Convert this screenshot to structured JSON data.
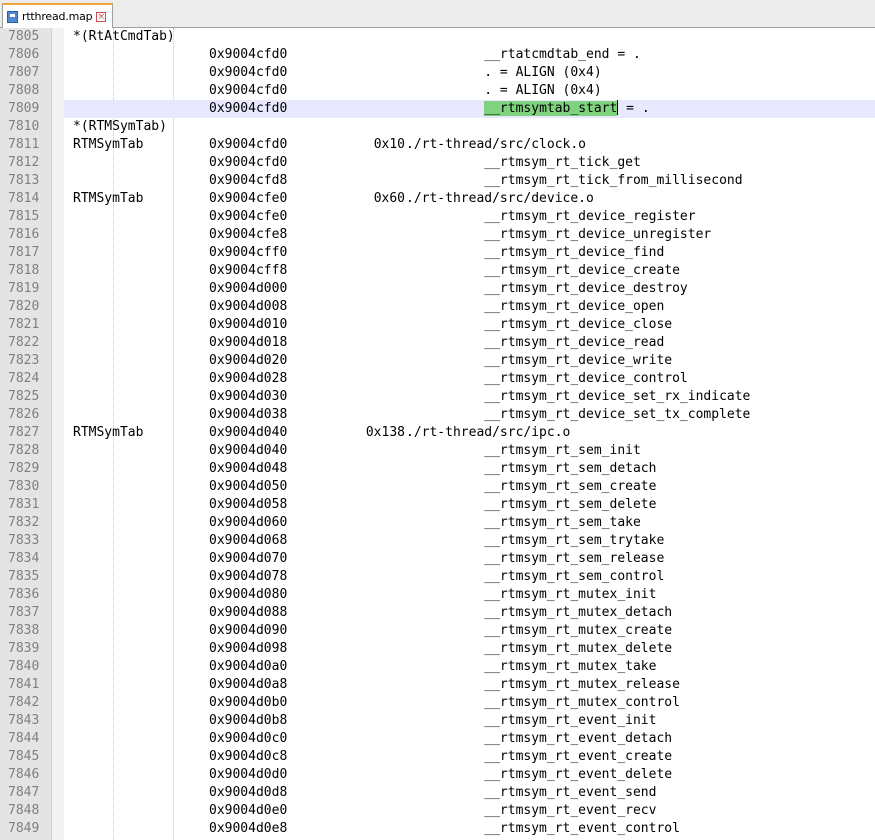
{
  "tab": {
    "title": "rtthread.map",
    "icon": "map-file-icon",
    "close_glyph": "×"
  },
  "editor": {
    "current_line": "7809",
    "selection": "__rtmsymtab_start",
    "lines": [
      {
        "num": "7805",
        "section": "*(RtAtCmdTab)",
        "addr": "",
        "size": "",
        "text": ""
      },
      {
        "num": "7806",
        "section": "",
        "addr": "0x9004cfd0",
        "size": "",
        "text": "          __rtatcmdtab_end = ."
      },
      {
        "num": "7807",
        "section": "",
        "addr": "0x9004cfd0",
        "size": "",
        "text": "          . = ALIGN (0x4)"
      },
      {
        "num": "7808",
        "section": "",
        "addr": "0x9004cfd0",
        "size": "",
        "text": "          . = ALIGN (0x4)"
      },
      {
        "num": "7809",
        "section": "",
        "addr": "0x9004cfd0",
        "size": "",
        "text": "          ",
        "sel": "__rtmsymtab_start",
        "after": " = ."
      },
      {
        "num": "7810",
        "section": "*(RTMSymTab)",
        "addr": "",
        "size": "",
        "text": ""
      },
      {
        "num": "7811",
        "section": "RTMSymTab",
        "addr": "0x9004cfd0",
        "size": "0x10",
        "text": "./rt-thread/src/clock.o"
      },
      {
        "num": "7812",
        "section": "",
        "addr": "0x9004cfd0",
        "size": "",
        "text": "          __rtmsym_rt_tick_get"
      },
      {
        "num": "7813",
        "section": "",
        "addr": "0x9004cfd8",
        "size": "",
        "text": "          __rtmsym_rt_tick_from_millisecond"
      },
      {
        "num": "7814",
        "section": "RTMSymTab",
        "addr": "0x9004cfe0",
        "size": "0x60",
        "text": "./rt-thread/src/device.o"
      },
      {
        "num": "7815",
        "section": "",
        "addr": "0x9004cfe0",
        "size": "",
        "text": "          __rtmsym_rt_device_register"
      },
      {
        "num": "7816",
        "section": "",
        "addr": "0x9004cfe8",
        "size": "",
        "text": "          __rtmsym_rt_device_unregister"
      },
      {
        "num": "7817",
        "section": "",
        "addr": "0x9004cff0",
        "size": "",
        "text": "          __rtmsym_rt_device_find"
      },
      {
        "num": "7818",
        "section": "",
        "addr": "0x9004cff8",
        "size": "",
        "text": "          __rtmsym_rt_device_create"
      },
      {
        "num": "7819",
        "section": "",
        "addr": "0x9004d000",
        "size": "",
        "text": "          __rtmsym_rt_device_destroy"
      },
      {
        "num": "7820",
        "section": "",
        "addr": "0x9004d008",
        "size": "",
        "text": "          __rtmsym_rt_device_open"
      },
      {
        "num": "7821",
        "section": "",
        "addr": "0x9004d010",
        "size": "",
        "text": "          __rtmsym_rt_device_close"
      },
      {
        "num": "7822",
        "section": "",
        "addr": "0x9004d018",
        "size": "",
        "text": "          __rtmsym_rt_device_read"
      },
      {
        "num": "7823",
        "section": "",
        "addr": "0x9004d020",
        "size": "",
        "text": "          __rtmsym_rt_device_write"
      },
      {
        "num": "7824",
        "section": "",
        "addr": "0x9004d028",
        "size": "",
        "text": "          __rtmsym_rt_device_control"
      },
      {
        "num": "7825",
        "section": "",
        "addr": "0x9004d030",
        "size": "",
        "text": "          __rtmsym_rt_device_set_rx_indicate"
      },
      {
        "num": "7826",
        "section": "",
        "addr": "0x9004d038",
        "size": "",
        "text": "          __rtmsym_rt_device_set_tx_complete"
      },
      {
        "num": "7827",
        "section": "RTMSymTab",
        "addr": "0x9004d040",
        "size": "0x138",
        "text": "./rt-thread/src/ipc.o"
      },
      {
        "num": "7828",
        "section": "",
        "addr": "0x9004d040",
        "size": "",
        "text": "          __rtmsym_rt_sem_init"
      },
      {
        "num": "7829",
        "section": "",
        "addr": "0x9004d048",
        "size": "",
        "text": "          __rtmsym_rt_sem_detach"
      },
      {
        "num": "7830",
        "section": "",
        "addr": "0x9004d050",
        "size": "",
        "text": "          __rtmsym_rt_sem_create"
      },
      {
        "num": "7831",
        "section": "",
        "addr": "0x9004d058",
        "size": "",
        "text": "          __rtmsym_rt_sem_delete"
      },
      {
        "num": "7832",
        "section": "",
        "addr": "0x9004d060",
        "size": "",
        "text": "          __rtmsym_rt_sem_take"
      },
      {
        "num": "7833",
        "section": "",
        "addr": "0x9004d068",
        "size": "",
        "text": "          __rtmsym_rt_sem_trytake"
      },
      {
        "num": "7834",
        "section": "",
        "addr": "0x9004d070",
        "size": "",
        "text": "          __rtmsym_rt_sem_release"
      },
      {
        "num": "7835",
        "section": "",
        "addr": "0x9004d078",
        "size": "",
        "text": "          __rtmsym_rt_sem_control"
      },
      {
        "num": "7836",
        "section": "",
        "addr": "0x9004d080",
        "size": "",
        "text": "          __rtmsym_rt_mutex_init"
      },
      {
        "num": "7837",
        "section": "",
        "addr": "0x9004d088",
        "size": "",
        "text": "          __rtmsym_rt_mutex_detach"
      },
      {
        "num": "7838",
        "section": "",
        "addr": "0x9004d090",
        "size": "",
        "text": "          __rtmsym_rt_mutex_create"
      },
      {
        "num": "7839",
        "section": "",
        "addr": "0x9004d098",
        "size": "",
        "text": "          __rtmsym_rt_mutex_delete"
      },
      {
        "num": "7840",
        "section": "",
        "addr": "0x9004d0a0",
        "size": "",
        "text": "          __rtmsym_rt_mutex_take"
      },
      {
        "num": "7841",
        "section": "",
        "addr": "0x9004d0a8",
        "size": "",
        "text": "          __rtmsym_rt_mutex_release"
      },
      {
        "num": "7842",
        "section": "",
        "addr": "0x9004d0b0",
        "size": "",
        "text": "          __rtmsym_rt_mutex_control"
      },
      {
        "num": "7843",
        "section": "",
        "addr": "0x9004d0b8",
        "size": "",
        "text": "          __rtmsym_rt_event_init"
      },
      {
        "num": "7844",
        "section": "",
        "addr": "0x9004d0c0",
        "size": "",
        "text": "          __rtmsym_rt_event_detach"
      },
      {
        "num": "7845",
        "section": "",
        "addr": "0x9004d0c8",
        "size": "",
        "text": "          __rtmsym_rt_event_create"
      },
      {
        "num": "7846",
        "section": "",
        "addr": "0x9004d0d0",
        "size": "",
        "text": "          __rtmsym_rt_event_delete"
      },
      {
        "num": "7847",
        "section": "",
        "addr": "0x9004d0d8",
        "size": "",
        "text": "          __rtmsym_rt_event_send"
      },
      {
        "num": "7848",
        "section": "",
        "addr": "0x9004d0e0",
        "size": "",
        "text": "          __rtmsym_rt_event_recv"
      },
      {
        "num": "7849",
        "section": "",
        "addr": "0x9004d0e8",
        "size": "",
        "text": "          __rtmsym_rt_event_control"
      }
    ]
  }
}
